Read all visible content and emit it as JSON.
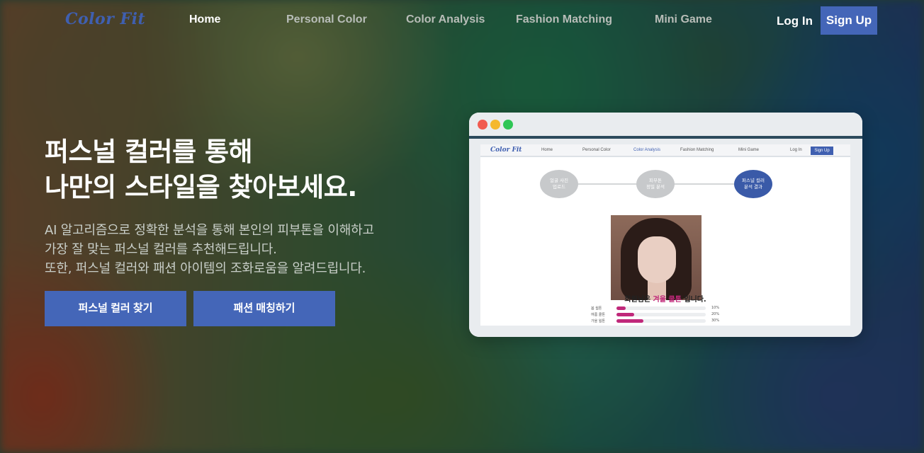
{
  "nav": {
    "logo": "Color Fit",
    "links": [
      "Home",
      "Personal Color",
      "Color Analysis",
      "Fashion Matching",
      "Mini Game"
    ],
    "active": "Home",
    "login": "Log In",
    "signup": "Sign Up"
  },
  "hero": {
    "title_line1": "퍼스널 컬러를 통해",
    "title_line2": "나만의 스타일을 찾아보세요.",
    "desc_line1": "AI 알고리즘으로 정확한 분석을 통해 본인의 피부톤을 이해하고",
    "desc_line2": "가장 잘 맞는 퍼스널 컬러를 추천해드립니다.",
    "desc_line3": "또한, 퍼스널 컬러와 패션 아이템의 조화로움을 알려드립니다.",
    "button_primary": "퍼스널 컬러 찾기",
    "button_secondary": "패션 매칭하기"
  },
  "preview": {
    "window_dots": [
      "#f15b50",
      "#f5b82e",
      "#2fc655"
    ],
    "mini_nav": {
      "logo": "Color Fit",
      "links": [
        "Home",
        "Personal Color",
        "Color Analysis",
        "Fashion Matching",
        "Mini Game"
      ],
      "active": "Color Analysis",
      "login": "Log In",
      "signup": "Sign Up"
    },
    "steps": [
      {
        "line1": "얼굴 사진",
        "line2": "업로드",
        "active": false
      },
      {
        "line1": "피부톤",
        "line2": "정밀 분석",
        "active": false
      },
      {
        "line1": "퍼스널 컬러",
        "line2": "분석 결과",
        "active": true
      }
    ],
    "result_prefix": "회원님은",
    "result_highlight": "겨울 쿨톤",
    "result_suffix": "입니다.",
    "bars": [
      {
        "label": "봄 웜톤",
        "value": 10,
        "pct": "10%"
      },
      {
        "label": "여름 쿨톤",
        "value": 20,
        "pct": "20%"
      },
      {
        "label": "가을 웜톤",
        "value": 30,
        "pct": "30%"
      }
    ]
  },
  "colors": {
    "accent": "#4466b8",
    "highlight": "#c0287a"
  }
}
